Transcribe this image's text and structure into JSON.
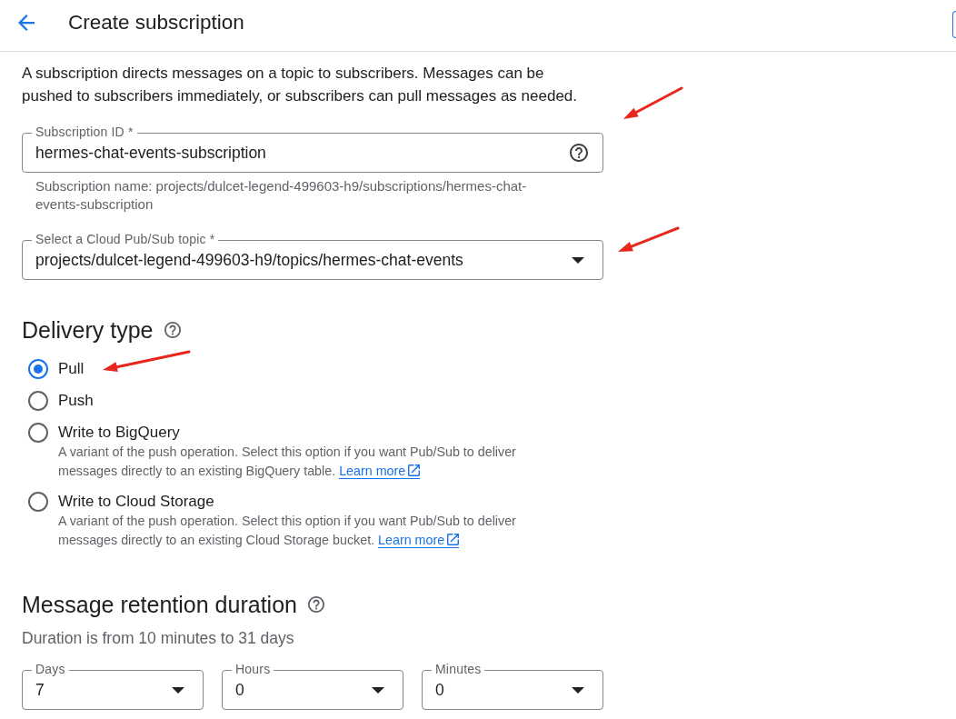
{
  "header": {
    "title": "Create subscription"
  },
  "intro": "A subscription directs messages on a topic to subscribers. Messages can be pushed to subscribers immediately, or subscribers can pull messages as needed.",
  "subscription_id": {
    "label": "Subscription ID *",
    "value": "hermes-chat-events-subscription",
    "hint": "Subscription name: projects/dulcet-legend-499603-h9/subscriptions/hermes-chat-events-subscription",
    "marked": true
  },
  "topic": {
    "label": "Select a Cloud Pub/Sub topic *",
    "value": "projects/dulcet-legend-499603-h9/topics/hermes-chat-events",
    "marked": true
  },
  "delivery_type": {
    "title": "Delivery type",
    "options": [
      {
        "label": "Pull",
        "selected": true,
        "marked": true
      },
      {
        "label": "Push",
        "selected": false
      },
      {
        "label": "Write to BigQuery",
        "selected": false,
        "description": "A variant of the push operation. Select this option if you want Pub/Sub to deliver messages directly to an existing BigQuery table.",
        "link": "Learn more"
      },
      {
        "label": "Write to Cloud Storage",
        "selected": false,
        "description": "A variant of the push operation. Select this option if you want Pub/Sub to deliver messages directly to an existing Cloud Storage bucket.",
        "link": "Learn more"
      }
    ]
  },
  "message_retention": {
    "title": "Message retention duration",
    "hint": "Duration is from 10 minutes to 31 days",
    "fields": [
      {
        "label": "Days",
        "value": "7"
      },
      {
        "label": "Hours",
        "value": "0"
      },
      {
        "label": "Minutes",
        "value": "0"
      }
    ]
  }
}
